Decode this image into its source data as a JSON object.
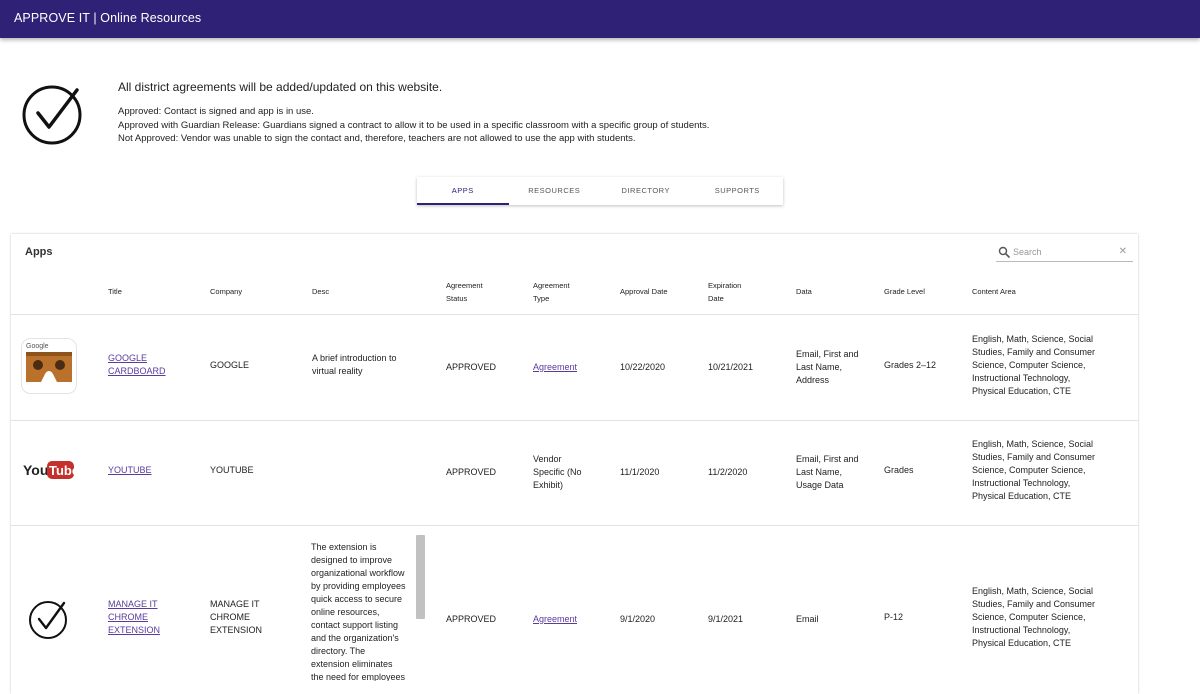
{
  "header": {
    "title": "APPROVE IT | Online Resources"
  },
  "intro": {
    "headline": "All district agreements will be added/updated on this website.",
    "lines": [
      "Approved: Contact is signed and app is in use.",
      "Approved with Guardian Release:  Guardians signed a contract to allow it to be used in a specific classroom with a specific group of students.",
      "Not Approved:  Vendor was unable to sign the contact and, therefore, teachers are not allowed to use the app with students."
    ]
  },
  "tabs": [
    "APPS",
    "RESOURCES",
    "DIRECTORY",
    "SUPPORTS"
  ],
  "apps": {
    "title": "Apps",
    "search_placeholder": "Search",
    "columns": {
      "title": "Title",
      "company": "Company",
      "desc": "Desc",
      "status_1": "Agreement",
      "status_2": "Status",
      "type_1": "Agreement",
      "type_2": "Type",
      "approval": "Approval Date",
      "expiration_1": "Expiration",
      "expiration_2": "Date",
      "data": "Data",
      "grade": "Grade Level",
      "content": "Content Area"
    },
    "rows": [
      {
        "icon": "google-cardboard-icon",
        "title": [
          "GOOGLE",
          "CARDBOARD"
        ],
        "company": "GOOGLE",
        "desc": [
          "A brief introduction to",
          "virtual reality"
        ],
        "status": "APPROVED",
        "type": "Agreement",
        "approval": "10/22/2020",
        "expiration": "10/21/2021",
        "data": [
          "Email, First and",
          "Last Name,",
          "Address"
        ],
        "grade": "Grades 2–12",
        "content": [
          "English, Math, Science, Social",
          "Studies, Family and Consumer",
          "Science, Computer Science,",
          "Instructional Technology,",
          "Physical Education, CTE"
        ],
        "logo_text": "Google"
      },
      {
        "icon": "youtube-icon",
        "title": [
          "YOUTUBE"
        ],
        "company": "YOUTUBE",
        "desc": [],
        "status": "APPROVED",
        "type_lines": [
          "Vendor",
          "Specific (No",
          "Exhibit)"
        ],
        "approval": "11/1/2020",
        "expiration": "11/2/2020",
        "data": [
          "Email, First and",
          "Last Name,",
          "Usage Data"
        ],
        "grade": "Grades",
        "content": [
          "English, Math, Science, Social",
          "Studies, Family and Consumer",
          "Science, Computer Science,",
          "Instructional Technology,",
          "Physical Education, CTE"
        ],
        "logo_you": "You",
        "logo_tube": "Tube"
      },
      {
        "icon": "checkmark-circle-icon",
        "title": [
          "MANAGE IT",
          "CHROME",
          "EXTENSION"
        ],
        "company": [
          "MANAGE IT",
          "CHROME",
          "EXTENSION"
        ],
        "desc": [
          "The extension is",
          "designed to improve",
          "organizational workflow",
          "by providing employees",
          "quick access to secure",
          "online resources,",
          "contact support listing",
          "and the organization's",
          "directory. The",
          "extension eliminates",
          "the need for employees"
        ],
        "status": "APPROVED",
        "type": "Agreement",
        "approval": "9/1/2020",
        "expiration": "9/1/2021",
        "data": [
          "Email"
        ],
        "grade": "P-12",
        "content": [
          "English, Math, Science, Social",
          "Studies, Family and Consumer",
          "Science, Computer Science,",
          "Instructional Technology,",
          "Physical Education, CTE"
        ]
      }
    ]
  },
  "colors": {
    "brand": "#2e2176",
    "link": "#5a3b9e"
  }
}
